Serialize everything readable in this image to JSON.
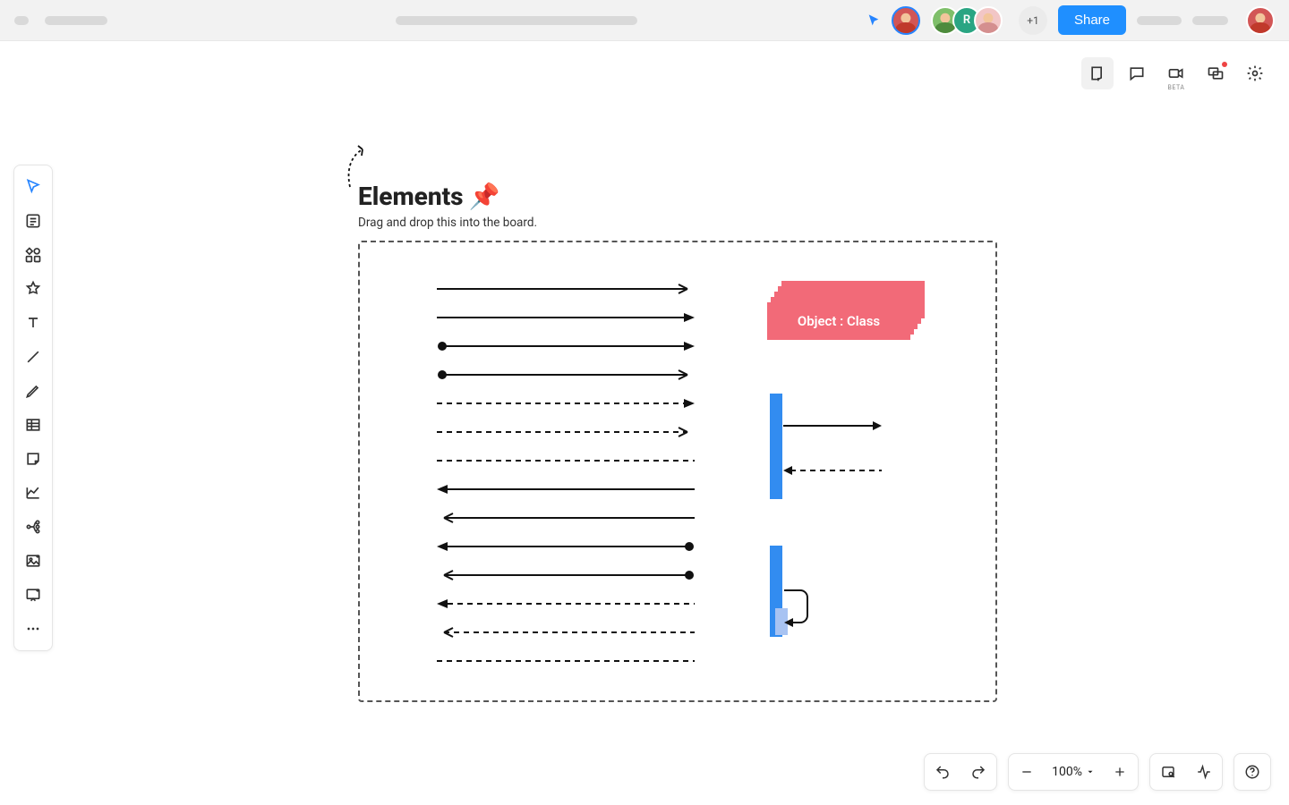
{
  "header": {
    "share_label": "Share",
    "extra_count": "+1",
    "avatars": [
      {
        "bg": "#d25656",
        "letter": ""
      },
      {
        "bg": "#7fbf6a",
        "letter": ""
      },
      {
        "bg": "#2aa583",
        "letter": "R"
      },
      {
        "bg": "#f2c6c6",
        "letter": ""
      }
    ],
    "me_avatar_bg": "#d25656"
  },
  "right_icons": {
    "beta_label": "BETA"
  },
  "canvas": {
    "title": "Elements",
    "title_emoji": "📌",
    "subtitle": "Drag and drop this into the board.",
    "object_label": "Object : Class"
  },
  "bottom": {
    "zoom_label": "100%"
  }
}
